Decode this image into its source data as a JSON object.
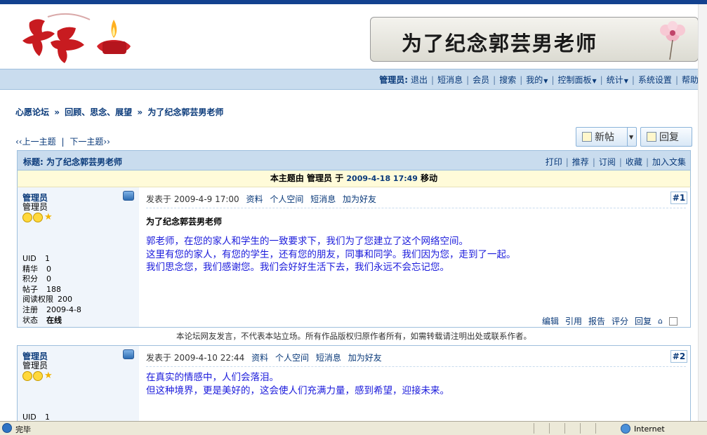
{
  "banner": {
    "text": "为了纪念郭芸男老师"
  },
  "nav": {
    "user_label": "管理员:",
    "items": [
      "退出",
      "短消息",
      "会员",
      "搜索",
      "我的",
      "控制面板",
      "统计",
      "系统设置",
      "帮助"
    ]
  },
  "breadcrumb": [
    "心愿论坛",
    "回顾、思念、展望",
    "为了纪念郭芸男老师"
  ],
  "pager": {
    "prev": "上一主题",
    "next": "下一主题",
    "prev_mark": "‹‹",
    "next_mark": "››"
  },
  "buttons": {
    "new": "新帖",
    "reply": "回复"
  },
  "thread": {
    "title": "标题: 为了纪念郭芸男老师",
    "actions": [
      "打印",
      "推荐",
      "订阅",
      "收藏",
      "加入文集"
    ],
    "notice_prefix": "本主题由 管理员 于",
    "notice_date": "2009-4-18 17:49",
    "notice_suffix": "移动"
  },
  "posts": [
    {
      "author": "管理员",
      "group": "管理员",
      "stats": [
        {
          "k": "UID",
          "v": "1"
        },
        {
          "k": "精华",
          "v": "0"
        },
        {
          "k": "积分",
          "v": "0"
        },
        {
          "k": "帖子",
          "v": "188"
        },
        {
          "k": "阅读权限",
          "v": "200"
        },
        {
          "k": "注册",
          "v": "2009-4-8"
        },
        {
          "k": "状态",
          "v": "在线"
        }
      ],
      "time": "发表于 2009-4-9 17:00",
      "links": [
        "资料",
        "个人空间",
        "短消息",
        "加为好友"
      ],
      "floor": "#1",
      "title": "为了纪念郭芸男老师",
      "lines": [
        "郭老师，在您的家人和学生的一致要求下，我们为了您建立了这个网络空间。",
        "这里有您的家人，有您的学生，还有您的朋友，同事和同学。我们因为您，走到了一起。",
        "我们思念您，我们感谢您。我们会好好生活下去，我们永远不会忘记您。"
      ],
      "actions": [
        "编辑",
        "引用",
        "报告",
        "评分",
        "回复"
      ]
    },
    {
      "author": "管理员",
      "group": "管理员",
      "stats": [
        {
          "k": "UID",
          "v": "1"
        }
      ],
      "time": "发表于 2009-4-10 22:44",
      "links": [
        "资料",
        "个人空间",
        "短消息",
        "加为好友"
      ],
      "floor": "#2",
      "lines": [
        "在真实的情感中，人们会落泪。",
        "但这种境界，更是美好的，这会使人们充满力量，感到希望，迎接未来。"
      ]
    }
  ],
  "disclaimer": "本论坛网友发言，不代表本站立场。所有作品版权归原作者所有，如需转载请注明出处或联系作者。",
  "statusbar": {
    "left": "完毕",
    "zone": "Internet"
  }
}
